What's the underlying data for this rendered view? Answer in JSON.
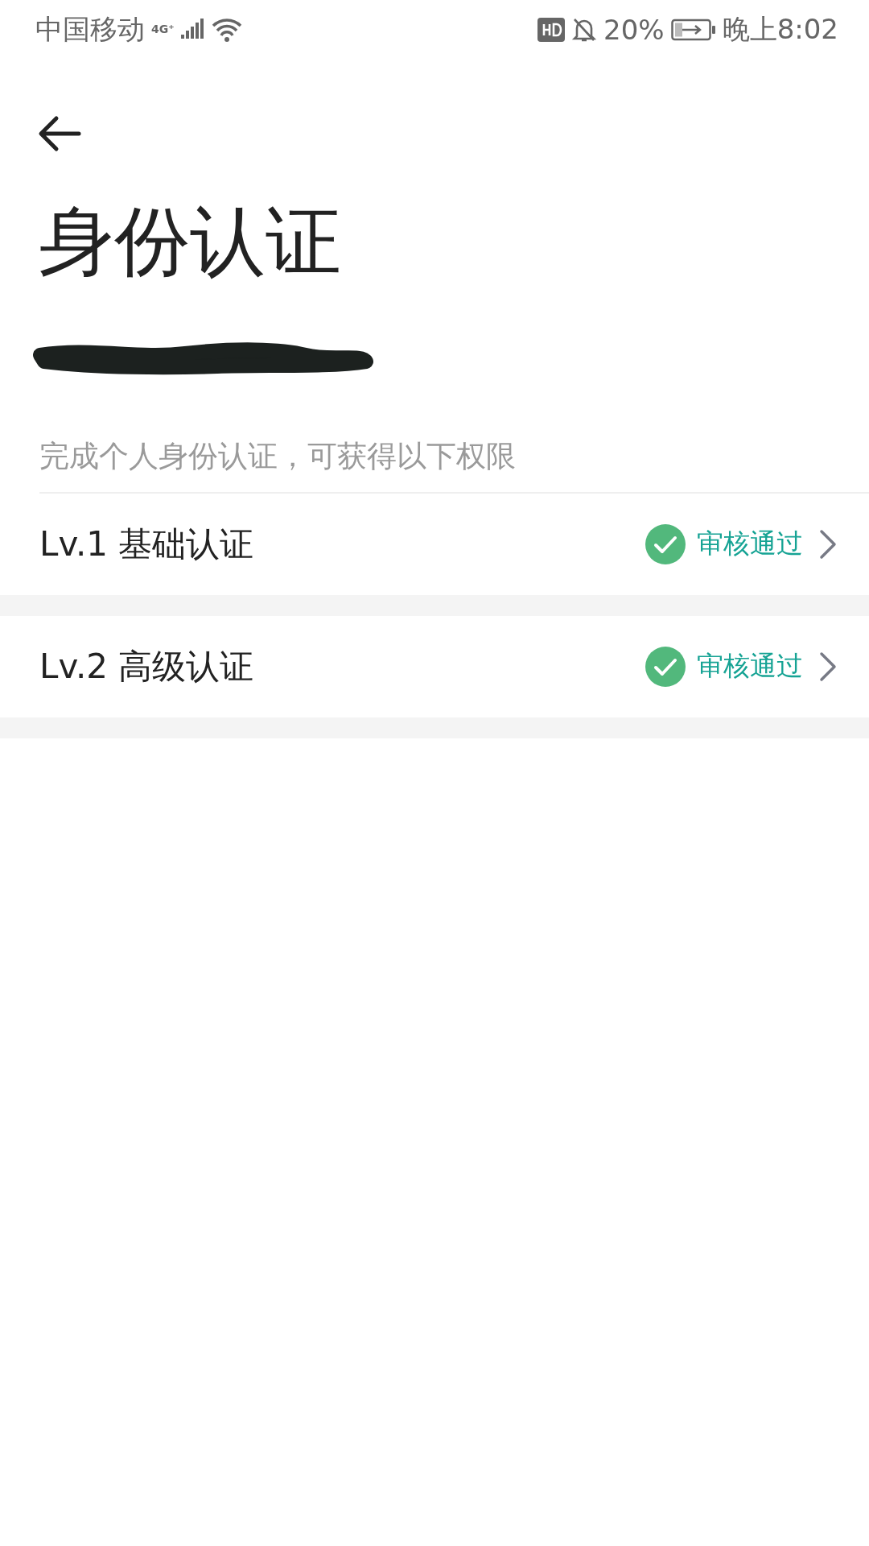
{
  "status_bar": {
    "carrier": "中国移动",
    "network": "4G⁺",
    "battery": "20%",
    "time": "晚上8:02"
  },
  "title": "身份认证",
  "subtitle": "完成个人身份认证，可获得以下权限",
  "levels": [
    {
      "label": "Lv.1 基础认证",
      "status": "审核通过",
      "kind": "approved"
    },
    {
      "label": "Lv.2 高级认证",
      "status": "审核通过",
      "kind": "approved"
    }
  ]
}
